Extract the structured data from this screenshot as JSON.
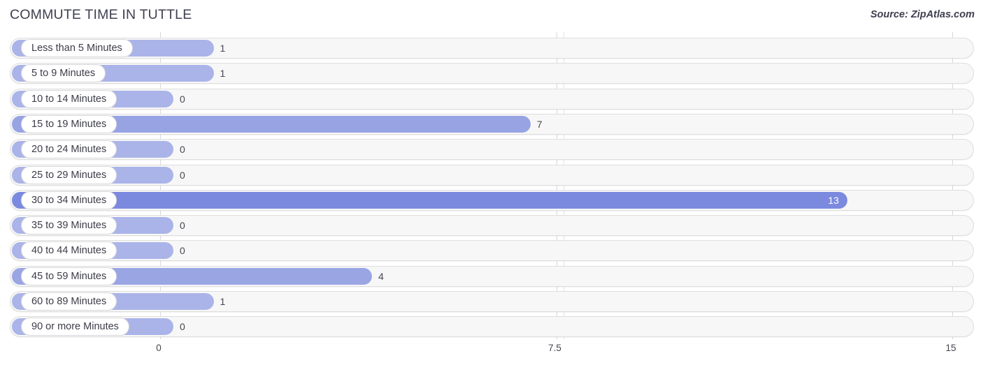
{
  "header": {
    "title": "COMMUTE TIME IN TUTTLE",
    "source": "Source: ZipAtlas.com"
  },
  "colors": {
    "bar_light": "#aab4e8",
    "bar_mid": "#97a3e3",
    "bar_dark": "#7b8ade",
    "track_fill": "#f7f7f7",
    "track_border": "#dededf",
    "gridline": "#d8d8dc",
    "text": "#3c3c48",
    "value_inside": "#ffffff"
  },
  "chart_data": {
    "type": "bar",
    "orientation": "horizontal",
    "title": "COMMUTE TIME IN TUTTLE",
    "xlabel": "",
    "ylabel": "",
    "xlim": [
      0,
      15
    ],
    "grid": true,
    "legend": false,
    "ticks": [
      "0",
      "7.5",
      "15"
    ],
    "tick_values": [
      0,
      7.5,
      15
    ],
    "categories": [
      "Less than 5 Minutes",
      "5 to 9 Minutes",
      "10 to 14 Minutes",
      "15 to 19 Minutes",
      "20 to 24 Minutes",
      "25 to 29 Minutes",
      "30 to 34 Minutes",
      "35 to 39 Minutes",
      "40 to 44 Minutes",
      "45 to 59 Minutes",
      "60 to 89 Minutes",
      "90 or more Minutes"
    ],
    "values": [
      1,
      1,
      0,
      7,
      0,
      0,
      13,
      0,
      0,
      4,
      1,
      0
    ],
    "value_labels": [
      "1",
      "1",
      "0",
      "7",
      "0",
      "0",
      "13",
      "0",
      "0",
      "4",
      "1",
      "0"
    ]
  }
}
